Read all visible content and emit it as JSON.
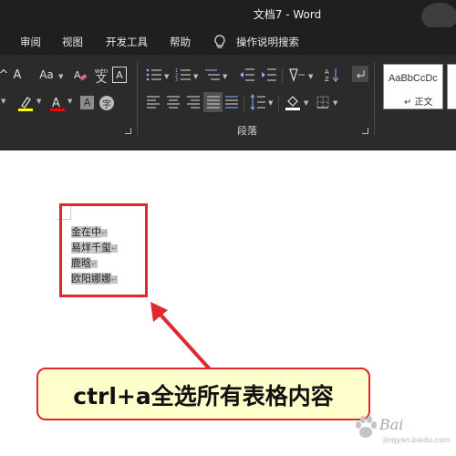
{
  "window": {
    "title": "文档7  -  Word"
  },
  "menu": {
    "tabs": [
      "审阅",
      "视图",
      "开发工具",
      "帮助"
    ],
    "search_label": "操作说明搜索"
  },
  "ribbon": {
    "font_group": {
      "change_case_label": "Aa",
      "phonetic_label": "wén",
      "char_border_label": "A",
      "shading_label": "A",
      "highlight_color": "#ffff00",
      "font_color": "#ff0000"
    },
    "paragraph_group": {
      "label": "段落"
    },
    "styles": {
      "sample_text": "AaBbCcDc",
      "normal_label": "正文"
    }
  },
  "document": {
    "lines": [
      "金在中",
      "易烊千玺",
      "鹿晗",
      "欧阳娜娜"
    ],
    "paragraph_mark": "↵"
  },
  "annotation": {
    "callout_text": "ctrl+a全选所有表格内容",
    "box_color": "#e0282f"
  },
  "watermark": {
    "text": "Bai",
    "sub": "jingyan.baidu.com"
  }
}
